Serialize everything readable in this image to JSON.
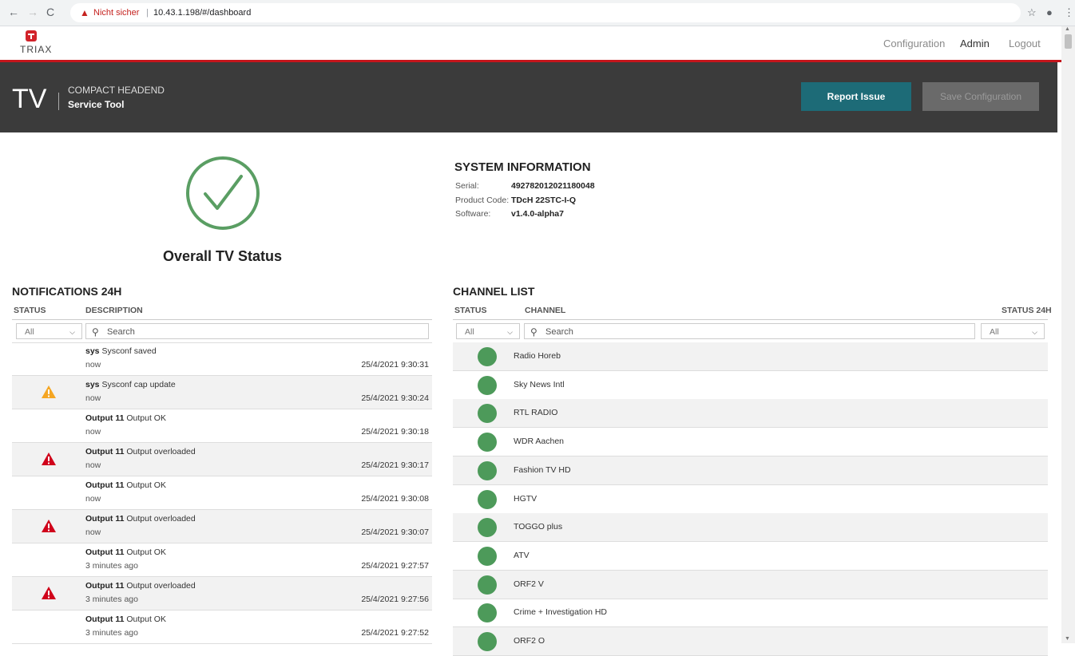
{
  "browser": {
    "security_warning": "Nicht sicher",
    "url": "10.43.1.198/#/dashboard"
  },
  "brand": {
    "logo_text": "TRIAX"
  },
  "topnav": {
    "configuration": "Configuration",
    "admin": "Admin",
    "logout": "Logout"
  },
  "banner": {
    "tv": "TV",
    "subtitle": "COMPACT HEADEND",
    "title": "Service Tool",
    "report_issue": "Report Issue",
    "save_configuration": "Save Configuration"
  },
  "status": {
    "label": "Overall TV Status"
  },
  "system_info": {
    "title": "SYSTEM INFORMATION",
    "rows": [
      {
        "key": "Serial:",
        "value": "492782012021180048"
      },
      {
        "key": "Product Code:",
        "value": "TDcH 22STC-I-Q"
      },
      {
        "key": "Software:",
        "value": "v1.4.0-alpha7"
      }
    ]
  },
  "notifications": {
    "title": "NOTIFICATIONS 24H",
    "col_status": "STATUS",
    "col_description": "DESCRIPTION",
    "filter_value": "All",
    "search_placeholder": "Search",
    "rows": [
      {
        "source": "sys",
        "message": "Sysconf saved",
        "ago": "now",
        "timestamp": "25/4/2021 9:30:31",
        "icon": "none"
      },
      {
        "source": "sys",
        "message": "Sysconf cap update",
        "ago": "now",
        "timestamp": "25/4/2021 9:30:24",
        "icon": "warning-orange"
      },
      {
        "source": "Output 11",
        "message": "Output OK",
        "ago": "now",
        "timestamp": "25/4/2021 9:30:18",
        "icon": "none"
      },
      {
        "source": "Output 11",
        "message": "Output overloaded",
        "ago": "now",
        "timestamp": "25/4/2021 9:30:17",
        "icon": "error-red"
      },
      {
        "source": "Output 11",
        "message": "Output OK",
        "ago": "now",
        "timestamp": "25/4/2021 9:30:08",
        "icon": "none"
      },
      {
        "source": "Output 11",
        "message": "Output overloaded",
        "ago": "now",
        "timestamp": "25/4/2021 9:30:07",
        "icon": "error-red"
      },
      {
        "source": "Output 11",
        "message": "Output OK",
        "ago": "3 minutes ago",
        "timestamp": "25/4/2021 9:27:57",
        "icon": "none"
      },
      {
        "source": "Output 11",
        "message": "Output overloaded",
        "ago": "3 minutes ago",
        "timestamp": "25/4/2021 9:27:56",
        "icon": "error-red"
      },
      {
        "source": "Output 11",
        "message": "Output OK",
        "ago": "3 minutes ago",
        "timestamp": "25/4/2021 9:27:52",
        "icon": "none"
      }
    ]
  },
  "channels": {
    "title": "CHANNEL LIST",
    "col_status": "STATUS",
    "col_channel": "CHANNEL",
    "col_status24": "STATUS 24H",
    "filter_value": "All",
    "filter24_value": "All",
    "search_placeholder": "Search",
    "rows": [
      {
        "name": "Radio Horeb"
      },
      {
        "name": "Sky News Intl"
      },
      {
        "name": "RTL RADIO"
      },
      {
        "name": "WDR Aachen"
      },
      {
        "name": "Fashion TV HD"
      },
      {
        "name": "HGTV"
      },
      {
        "name": "TOGGO plus"
      },
      {
        "name": "ATV"
      },
      {
        "name": "ORF2 V"
      },
      {
        "name": "Crime + Investigation HD"
      },
      {
        "name": "ORF2 O"
      }
    ]
  },
  "colors": {
    "accent_red": "#c4161c",
    "teal": "#1d6b77",
    "ok_green": "#4d9a5a",
    "warn_orange": "#f5a623",
    "error_red": "#d0021b"
  }
}
